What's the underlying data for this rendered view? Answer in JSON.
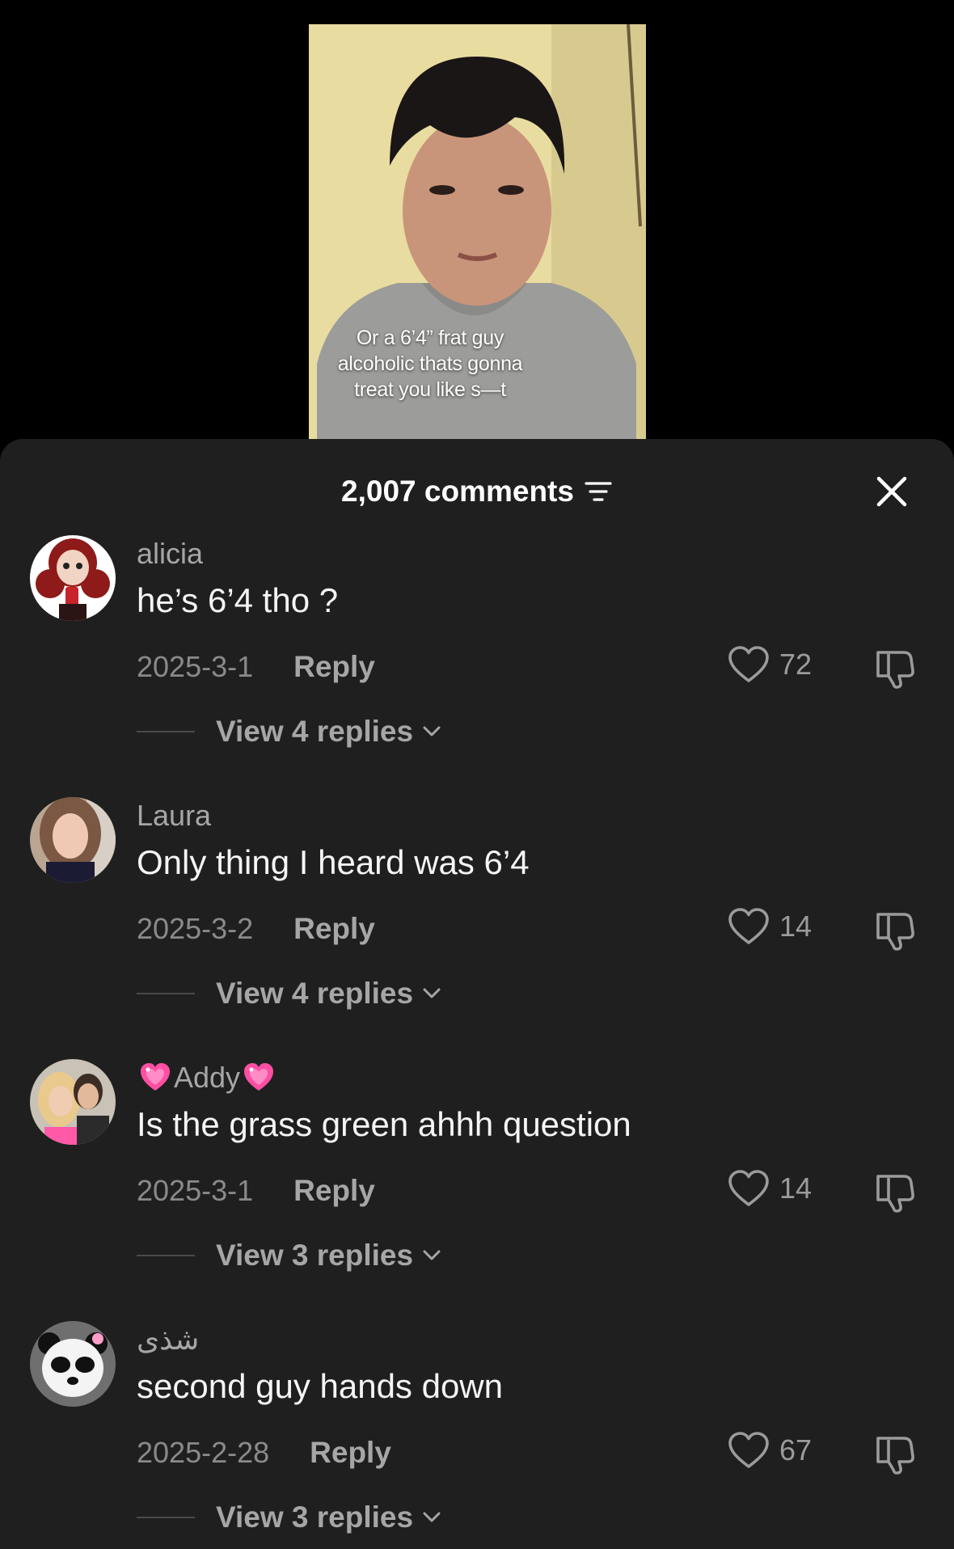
{
  "video": {
    "caption_lines": [
      "Or a 6’4” frat guy",
      "alcoholic thats gonna",
      "treat you like s—t"
    ]
  },
  "sheet": {
    "comment_count": "2,007 comments",
    "sort_icon": "sort-lines-icon",
    "close_icon": "close-icon"
  },
  "comments": [
    {
      "username": "alicia",
      "text": "he’s 6’4 tho ?",
      "date": "2025-3-1",
      "reply_label": "Reply",
      "likes": "72",
      "replies_label": "View 4 replies"
    },
    {
      "username": "Laura",
      "text": "Only thing I heard was 6’4",
      "date": "2025-3-2",
      "reply_label": "Reply",
      "likes": "14",
      "replies_label": "View 4 replies"
    },
    {
      "username": "Addy",
      "text": "Is the grass green ahhh question",
      "date": "2025-3-1",
      "reply_label": "Reply",
      "likes": "14",
      "replies_label": "View 3 replies"
    },
    {
      "username": "شذى",
      "text": "second guy hands down",
      "date": "2025-2-28",
      "reply_label": "Reply",
      "likes": "67",
      "replies_label": "View 3 replies"
    }
  ],
  "colors": {
    "sheet_bg": "#1f1f1f",
    "secondary_text": "#a6a6a6",
    "heart_emoji": "#ff4fa3"
  }
}
